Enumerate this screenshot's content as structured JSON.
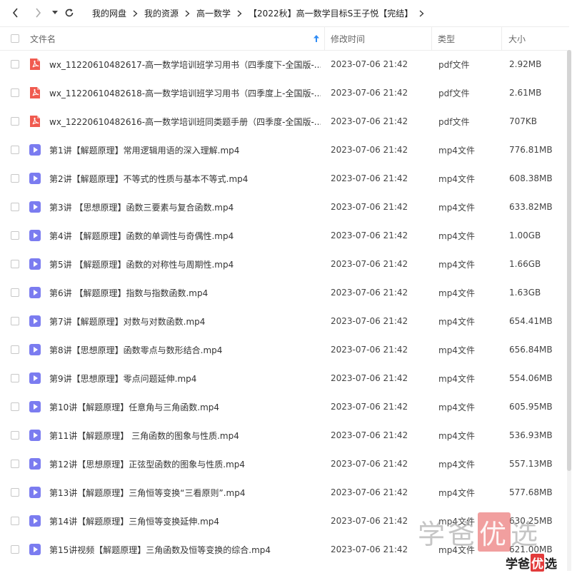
{
  "toolbar": {
    "breadcrumbs": [
      "我的网盘",
      "我的资源",
      "高一数学",
      "【2022秋】高一数学目标S王子悦【完结】"
    ]
  },
  "table": {
    "columns": {
      "name": "文件名",
      "modified": "修改时间",
      "type": "类型",
      "size": "大小"
    },
    "sort_column": "name",
    "rows": [
      {
        "icon": "pdf-icon",
        "name": "wx_11220610482617-高一数学培训班学习用书（四季度下-全国版-...",
        "modified": "2023-07-06 21:42",
        "type": "pdf文件",
        "size": "2.92MB"
      },
      {
        "icon": "pdf-icon",
        "name": "wx_11220610482618-高一数学培训班学习用书（四季度上-全国版-...",
        "modified": "2023-07-06 21:42",
        "type": "pdf文件",
        "size": "2.61MB"
      },
      {
        "icon": "pdf-icon",
        "name": "wx_12220610482616-高一数学培训班同类题手册（四季度-全国版-...",
        "modified": "2023-07-06 21:42",
        "type": "pdf文件",
        "size": "707KB"
      },
      {
        "icon": "video-icon",
        "name": "第1讲【解题原理】常用逻辑用语的深入理解.mp4",
        "modified": "2023-07-06 21:42",
        "type": "mp4文件",
        "size": "776.81MB"
      },
      {
        "icon": "video-icon",
        "name": "第2讲【解题原理】不等式的性质与基本不等式.mp4",
        "modified": "2023-07-06 21:42",
        "type": "mp4文件",
        "size": "608.38MB"
      },
      {
        "icon": "video-icon",
        "name": "第3讲 【思想原理】函数三要素与复合函数.mp4",
        "modified": "2023-07-06 21:42",
        "type": "mp4文件",
        "size": "633.82MB"
      },
      {
        "icon": "video-icon",
        "name": "第4讲 【解题原理】函数的单调性与奇偶性.mp4",
        "modified": "2023-07-06 21:42",
        "type": "mp4文件",
        "size": "1.00GB"
      },
      {
        "icon": "video-icon",
        "name": "第5讲 【解题原理】函数的对称性与周期性.mp4",
        "modified": "2023-07-06 21:42",
        "type": "mp4文件",
        "size": "1.66GB"
      },
      {
        "icon": "video-icon",
        "name": "第6讲 【解题原理】指数与指数函数.mp4",
        "modified": "2023-07-06 21:42",
        "type": "mp4文件",
        "size": "1.63GB"
      },
      {
        "icon": "video-icon",
        "name": "第7讲【解题原理】对数与对数函数.mp4",
        "modified": "2023-07-06 21:42",
        "type": "mp4文件",
        "size": "654.41MB"
      },
      {
        "icon": "video-icon",
        "name": "第8讲【思想原理】函数零点与数形结合.mp4",
        "modified": "2023-07-06 21:42",
        "type": "mp4文件",
        "size": "656.84MB"
      },
      {
        "icon": "video-icon",
        "name": "第9讲【思想原理】零点问题延伸.mp4",
        "modified": "2023-07-06 21:42",
        "type": "mp4文件",
        "size": "554.06MB"
      },
      {
        "icon": "video-icon",
        "name": "第10讲【解题原理】任意角与三角函数.mp4",
        "modified": "2023-07-06 21:42",
        "type": "mp4文件",
        "size": "605.95MB"
      },
      {
        "icon": "video-icon",
        "name": "第11讲【解题原理】 三角函数的图象与性质.mp4",
        "modified": "2023-07-06 21:42",
        "type": "mp4文件",
        "size": "536.93MB"
      },
      {
        "icon": "video-icon",
        "name": "第12讲【思想原理】正弦型函数的图象与性质.mp4",
        "modified": "2023-07-06 21:42",
        "type": "mp4文件",
        "size": "557.13MB"
      },
      {
        "icon": "video-icon",
        "name": "第13讲【解题原理】三角恒等变换“三看原则”.mp4",
        "modified": "2023-07-06 21:42",
        "type": "mp4文件",
        "size": "577.68MB"
      },
      {
        "icon": "video-icon",
        "name": "第14讲【解题原理】三角恒等变换延伸.mp4",
        "modified": "2023-07-06 21:42",
        "type": "mp4文件",
        "size": "630.25MB"
      },
      {
        "icon": "video-icon",
        "name": "第15讲视频【解题原理】三角函数及恒等变换的综合.mp4",
        "modified": "2023-07-06 21:42",
        "type": "mp4文件",
        "size": "621.00MB"
      }
    ]
  },
  "watermark": {
    "chars": [
      "学",
      "爸",
      "优",
      "选"
    ]
  },
  "colors": {
    "pdf": "#f05a4f",
    "video": "#7b7cf0",
    "sort_arrow": "#2f8cf5"
  }
}
